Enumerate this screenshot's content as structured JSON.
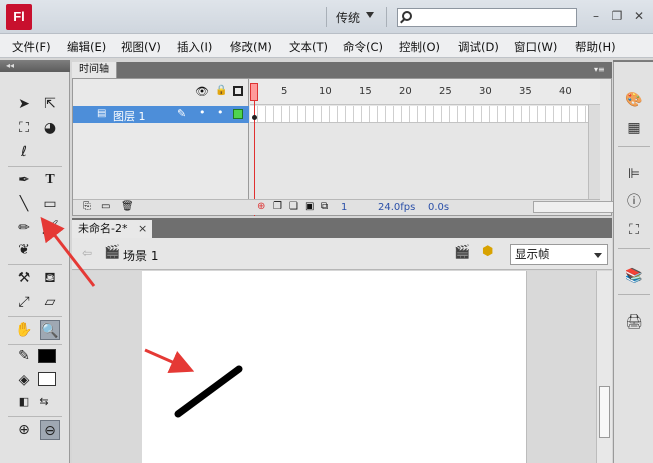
{
  "titlebar": {
    "logo": "Fl",
    "workspace": "传统",
    "search_placeholder": ""
  },
  "menu": [
    "文件(F)",
    "编辑(E)",
    "视图(V)",
    "插入(I)",
    "修改(M)",
    "文本(T)",
    "命令(C)",
    "控制(O)",
    "调试(D)",
    "窗口(W)",
    "帮助(H)"
  ],
  "timeline": {
    "tab": "时间轴",
    "layer_name": "图层 1",
    "ruler": [
      "1",
      "5",
      "10",
      "15",
      "20",
      "25",
      "30",
      "35",
      "40"
    ],
    "current_frame": "1",
    "fps": "24.0fps",
    "elapsed": "0.0s"
  },
  "document": {
    "tab": "未命名-2*",
    "close_glyph": "×",
    "scene": "场景 1",
    "frame_view": "显示帧"
  },
  "tools": {
    "text_tool": "T"
  },
  "colors": {
    "layer_highlight": "#4d8ed9",
    "playhead": "#e03030",
    "annotation_arrow": "#e53935",
    "stroke_color": "#000000",
    "fill_color": "#ffffff"
  }
}
